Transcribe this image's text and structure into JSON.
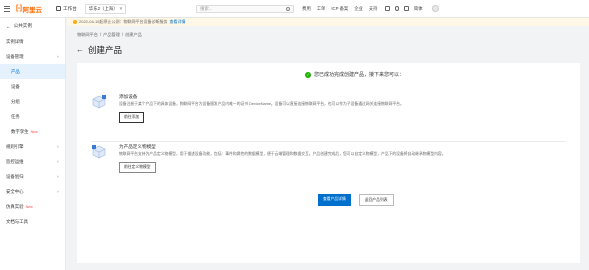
{
  "topbar": {
    "logo_mark": "[-]",
    "logo_text": "阿里云",
    "workbench": "工作台",
    "region": "华东2（上海）",
    "search_placeholder": "搜索...",
    "links": [
      "费用",
      "工单",
      "ICP 备案",
      "企业",
      "支持"
    ],
    "lang": "简体"
  },
  "sidebar": {
    "back_label": "公共实例",
    "items": [
      {
        "label": "实例详情",
        "indent": false,
        "active": false,
        "chevron": ""
      },
      {
        "label": "设备管理",
        "indent": false,
        "active": false,
        "chevron": "˄"
      },
      {
        "label": "产品",
        "indent": true,
        "active": true,
        "chevron": ""
      },
      {
        "label": "设备",
        "indent": true,
        "active": false,
        "chevron": ""
      },
      {
        "label": "分组",
        "indent": true,
        "active": false,
        "chevron": ""
      },
      {
        "label": "任务",
        "indent": true,
        "active": false,
        "chevron": ""
      },
      {
        "label": "数字孪生",
        "indent": true,
        "active": false,
        "chevron": "",
        "badge": "New"
      },
      {
        "label": "规则引擎",
        "indent": false,
        "active": false,
        "chevron": "˅"
      },
      {
        "label": "监控运维",
        "indent": false,
        "active": false,
        "chevron": "˅"
      },
      {
        "label": "设备划归",
        "indent": false,
        "active": false,
        "chevron": "˅"
      },
      {
        "label": "安全中心",
        "indent": false,
        "active": false,
        "chevron": "˅"
      },
      {
        "label": "仿真实验",
        "indent": false,
        "active": false,
        "chevron": "",
        "badge": "New"
      },
      {
        "label": "文档与工具",
        "indent": false,
        "active": false,
        "chevron": ""
      }
    ]
  },
  "notice": {
    "text": "2022-04-15起停止公测：物联网平台设备诊断服务",
    "link": "查看详情"
  },
  "breadcrumb": [
    "物联网平台",
    "/",
    "产品管理",
    "/",
    "创建产品"
  ],
  "page_title": "创建产品",
  "success_text": "您已成功完成创建产品，接下来您可以：",
  "steps": [
    {
      "title": "添加设备",
      "desc": "设备注册于某个产品下的具体设备，物联网平台为设备颁发产品内唯一的证书 DeviceName。设备可以直接连接物联网平台，也可以作为子设备通过网关连接物联网平台。",
      "button": "前往添加"
    },
    {
      "title": "为产品定义物模型",
      "desc": "物联网平台支持为产品定义物模型，用于描述设备功能，包括：事件和属性的数据模型，便于云端管理和数据交互。产品创建完成后，您可以自定义物模型，产品下的设备将自动继承物模型内容。",
      "button": "前往定义物模型"
    }
  ],
  "footer": {
    "primary": "查看产品详情",
    "secondary": "返回产品列表"
  }
}
